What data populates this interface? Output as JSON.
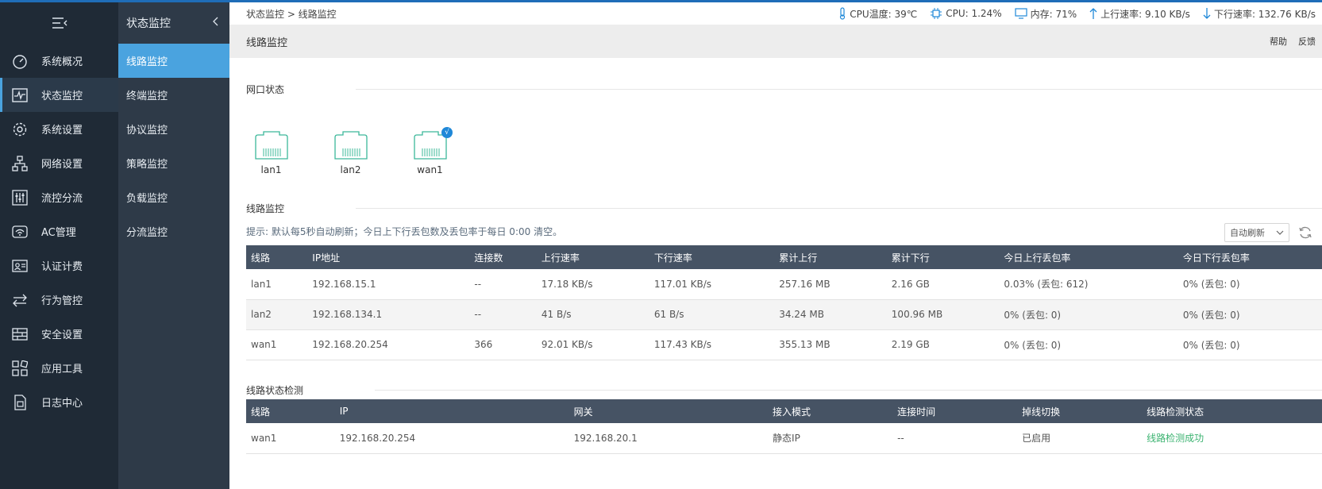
{
  "sidebar": {
    "items": [
      {
        "label": "系统概况",
        "icon": "dashboard-icon"
      },
      {
        "label": "状态监控",
        "icon": "pulse-icon",
        "active": true
      },
      {
        "label": "系统设置",
        "icon": "gear-icon"
      },
      {
        "label": "网络设置",
        "icon": "network-icon"
      },
      {
        "label": "流控分流",
        "icon": "sliders-icon"
      },
      {
        "label": "AC管理",
        "icon": "wifi-icon"
      },
      {
        "label": "认证计费",
        "icon": "id-card-icon"
      },
      {
        "label": "行为管控",
        "icon": "arrows-icon"
      },
      {
        "label": "安全设置",
        "icon": "firewall-icon"
      },
      {
        "label": "应用工具",
        "icon": "apps-icon"
      },
      {
        "label": "日志中心",
        "icon": "log-icon"
      }
    ]
  },
  "subnav": {
    "title": "状态监控",
    "items": [
      {
        "label": "线路监控",
        "active": true
      },
      {
        "label": "终端监控"
      },
      {
        "label": "协议监控"
      },
      {
        "label": "策略监控"
      },
      {
        "label": "负载监控"
      },
      {
        "label": "分流监控"
      }
    ]
  },
  "status": {
    "breadcrumb": "状态监控 > 线路监控",
    "cpu_temp": "CPU温度: 39℃",
    "cpu": "CPU: 1.24%",
    "memory": "内存: 71%",
    "upload": "上行速率: 9.10 KB/s",
    "download": "下行速率: 132.76 KB/s"
  },
  "header": {
    "title": "线路监控",
    "help": "帮助",
    "feedback": "反馈"
  },
  "ports_section": {
    "title": "网口状态",
    "ports": [
      {
        "name": "lan1",
        "active": false
      },
      {
        "name": "lan2",
        "active": false
      },
      {
        "name": "wan1",
        "active": true
      }
    ],
    "check_mark": "√"
  },
  "line_section": {
    "title": "线路监控",
    "hint": "提示: 默认每5秒自动刷新；今日上下行丢包数及丢包率于每日 0:00 清空。",
    "refresh_select": "自动刷新",
    "columns": [
      "线路",
      "IP地址",
      "连接数",
      "上行速率",
      "下行速率",
      "累计上行",
      "累计下行",
      "今日上行丢包率",
      "今日下行丢包率"
    ],
    "rows": [
      [
        "lan1",
        "192.168.15.1",
        "--",
        "17.18 KB/s",
        "117.01 KB/s",
        "257.16 MB",
        "2.16 GB",
        "0.03% (丢包: 612)",
        "0% (丢包: 0)"
      ],
      [
        "lan2",
        "192.168.134.1",
        "--",
        "41 B/s",
        "61 B/s",
        "34.24 MB",
        "100.96 MB",
        "0% (丢包: 0)",
        "0% (丢包: 0)"
      ],
      [
        "wan1",
        "192.168.20.254",
        "366",
        "92.01 KB/s",
        "117.43 KB/s",
        "355.13 MB",
        "2.19 GB",
        "0% (丢包: 0)",
        "0% (丢包: 0)"
      ]
    ]
  },
  "detect_section": {
    "title": "线路状态检测",
    "columns": [
      "线路",
      "IP",
      "网关",
      "接入模式",
      "连接时间",
      "掉线切换",
      "线路检测状态"
    ],
    "rows": [
      [
        "wan1",
        "192.168.20.254",
        "192.168.20.1",
        "静态IP",
        "--",
        "已启用",
        "线路检测成功"
      ]
    ]
  },
  "colors": {
    "accent": "#4aa3df",
    "sidebar_bg": "#1f2a36",
    "table_header": "#465364",
    "port_green": "#3cb89a",
    "success": "#3cb371"
  }
}
